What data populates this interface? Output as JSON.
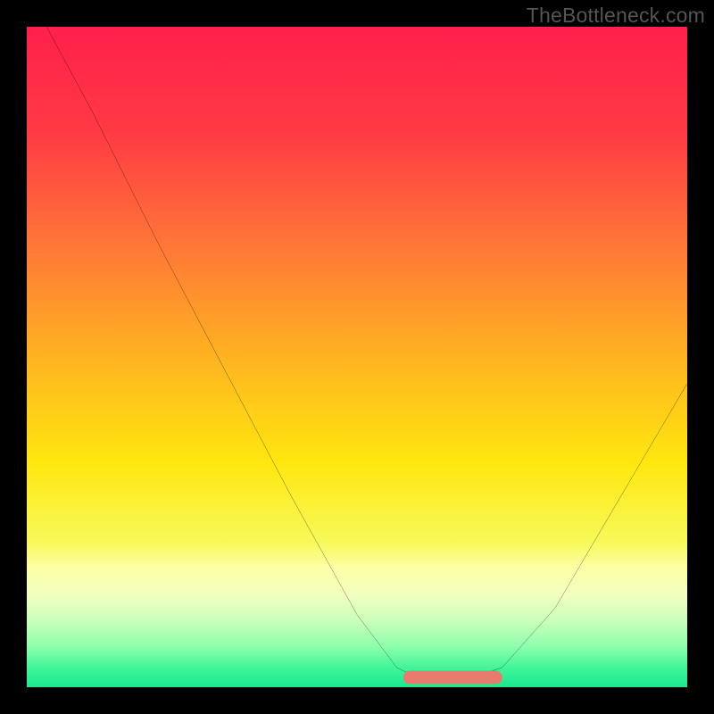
{
  "watermark": "TheBottleneck.com",
  "chart_data": {
    "type": "line",
    "title": "",
    "xlabel": "",
    "ylabel": "",
    "xlim": [
      0,
      100
    ],
    "ylim": [
      0,
      100
    ],
    "grid": false,
    "legend": false,
    "series": [
      {
        "name": "bottleneck-curve",
        "x": [
          3,
          10,
          20,
          30,
          40,
          50,
          56,
          60,
          66,
          72,
          80,
          90,
          100
        ],
        "y_pct_from_top": [
          0,
          13,
          33,
          52,
          71,
          89,
          97,
          99,
          99,
          97,
          88,
          71,
          54
        ],
        "stroke": "#000000",
        "stroke_width": 2
      }
    ],
    "annotations": [
      {
        "name": "min-plateau",
        "shape": "rounded-bar",
        "x_start": 57,
        "x_end": 72,
        "y_pct_from_top": 98.5,
        "height_pct": 2,
        "fill": "#e97a6e"
      }
    ],
    "background_gradient": {
      "stops": [
        {
          "offset": 0.0,
          "color": "#ff1f4b"
        },
        {
          "offset": 0.16,
          "color": "#ff3a44"
        },
        {
          "offset": 0.34,
          "color": "#ff7a36"
        },
        {
          "offset": 0.5,
          "color": "#ffb321"
        },
        {
          "offset": 0.66,
          "color": "#ffe70f"
        },
        {
          "offset": 0.78,
          "color": "#f7f95a"
        },
        {
          "offset": 0.82,
          "color": "#fdffa8"
        },
        {
          "offset": 0.86,
          "color": "#f2ffbf"
        },
        {
          "offset": 0.9,
          "color": "#c9ffba"
        },
        {
          "offset": 0.94,
          "color": "#8affab"
        },
        {
          "offset": 0.97,
          "color": "#42f59a"
        },
        {
          "offset": 1.0,
          "color": "#19e98f"
        }
      ]
    }
  }
}
